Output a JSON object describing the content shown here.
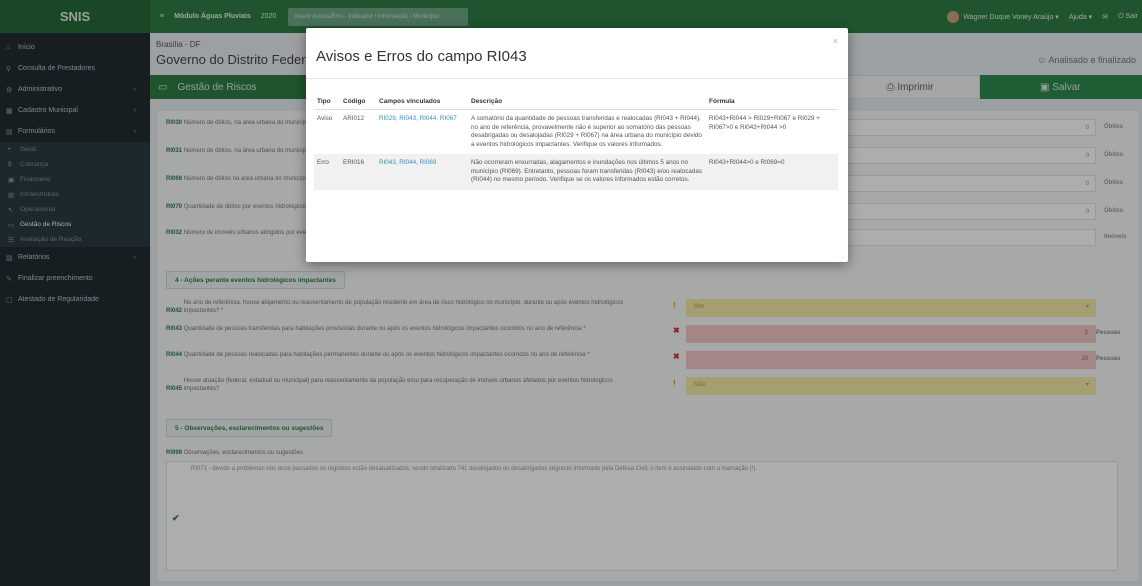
{
  "topbar": {
    "brand": "SNIS",
    "menu_icon": "≡",
    "module": "Módulo Águas Pluviais",
    "year": "2020",
    "search_placeholder": "Inserir Avisos/Erro - Indicador / Informação - Município",
    "user": "Wagner Duque Voney Araújo",
    "help": "Ajuda",
    "exit": "Sair"
  },
  "sidebar": {
    "items": [
      {
        "label": "Início",
        "icon": "home-icon",
        "glyph": "⌂"
      },
      {
        "label": "Consulta de Prestadores",
        "icon": "search-icon",
        "glyph": "⚲"
      },
      {
        "label": "Administrativo",
        "icon": "gear-icon",
        "glyph": "⚙"
      },
      {
        "label": "Cadastro Municipal",
        "icon": "grid-icon",
        "glyph": "▦"
      },
      {
        "label": "Formulários",
        "icon": "forms-icon",
        "glyph": "▤"
      }
    ],
    "subitems": [
      {
        "label": "Geral",
        "glyph": "•"
      },
      {
        "label": "Cobrança",
        "glyph": "$"
      },
      {
        "label": "Financeiro",
        "glyph": "▣"
      },
      {
        "label": "Infraestrutura",
        "glyph": "▥"
      },
      {
        "label": "Operacional",
        "glyph": "↖"
      },
      {
        "label": "Gestão de Riscos",
        "glyph": "▭"
      },
      {
        "label": "Avaliação de Reação",
        "glyph": "☰"
      }
    ],
    "bottom": [
      {
        "label": "Relatórios",
        "glyph": "▨"
      },
      {
        "label": "Finalizar preenchimento",
        "glyph": "✎"
      },
      {
        "label": "Atestado de Regularidade",
        "glyph": "▢"
      }
    ]
  },
  "main": {
    "breadcrumb": "Brasília - DF",
    "org": "Governo do Distrito Federal",
    "status": "Analisado e finalizado",
    "section_title": "Gestão de Riscos",
    "print_label": "Imprimir",
    "save_label": "Salvar",
    "rows": [
      {
        "code": "RI030",
        "text": "Número de óbitos, na área urbana do município, decorrentes de eventos hidrológicos impactantes no ano de referência, registrado no sistema eletrônico da Secretaria",
        "value": "0",
        "unit": "Óbitos"
      },
      {
        "code": "RI031",
        "text": "Número de óbitos, na área urbana do município, decorrentes de eventos hidrológicos impactantes no ano de referência, registrado no sistema eletrônico da Secretaria",
        "value": "0",
        "unit": "Óbitos"
      },
      {
        "code": "RI068",
        "text": "Número de óbitos na área urbana do município decorrentes de eventos hidrológicos impactantes no ano de referência que não foi registrado no sistema eletrônico",
        "value": "0",
        "unit": "Óbitos"
      },
      {
        "code": "RI070",
        "text": "Quantidade de óbitos por eventos hidrológicos impactantes",
        "value": "0",
        "unit": "Óbitos"
      },
      {
        "code": "RI032",
        "text": "Número de imóveis urbanos atingidos por eventos hidrológicos impactantes",
        "value": "",
        "unit": "Imóveis"
      }
    ],
    "section4": "4 - Ações perante eventos hidrológicos impactantes",
    "questions": [
      {
        "code": "RI042",
        "text": "No ano de referência, houve alojamento ou reassentamento de população residente em área de risco hidrológico no município, durante ou após eventos hidrológicos impactantes? *",
        "value": "Sim",
        "kind": "yes",
        "mark": "!",
        "unit": ""
      },
      {
        "code": "RI043",
        "text": "Quantidade de pessoas transferidas para habitações provisórias durante ou após os eventos hidrológicos impactantes ocorridos no ano de referência *",
        "value": "2",
        "kind": "err",
        "mark": "✖",
        "unit": "Pessoas"
      },
      {
        "code": "RI044",
        "text": "Quantidade de pessoas realocadas para habitações permanentes durante ou após os eventos hidrológicos impactantes ocorridos no ano de referência *",
        "value": "10",
        "kind": "err",
        "mark": "✖",
        "unit": "Pessoas"
      },
      {
        "code": "RI045",
        "text": "Houve atuação (federal, estadual ou municipal) para reassentamento da população e/ou para recuperação de imóveis urbanos afetados por eventos hidrológicos impactantes?",
        "value": "Não",
        "kind": "yes",
        "mark": "!",
        "unit": ""
      }
    ],
    "section5": "5 - Observações, esclarecimentos ou sugestões",
    "obs_code": "RI999",
    "obs_label": "Observações, esclarecimentos ou sugestões",
    "obs_text": "RI071 - devido a problemas nos anos passados os registros estão desatualizados, sendo totalizado 741 desalojados ou desabrigados segundo informado pela Defesa Civil; o item é assinalado com a marcação (!)."
  },
  "modal": {
    "title": "Avisos e Erros do campo RI043",
    "close": "×",
    "headers": [
      "Tipo",
      "Código",
      "Campos vinculados",
      "Descrição",
      "Fórmula"
    ],
    "rows": [
      {
        "tipo": "Aviso",
        "codigo": "ARI012",
        "campos": "RI029, RI043, RI044, RI067",
        "descricao": "A somatório da quantidade de pessoas transferidas e realocadas (RI043 + RI044), no ano de referência, provavelmente não é superior ao somatório das pessoas desabrigadas ou desalojadas (RI029 + RI067) na área urbana do município devido a eventos hidrológicos impactantes. Verifique os valores informados.",
        "formula": "RI043+RI044 > RI029+RI067 e RI029 + RI067>0 e RI043+RI044 >0"
      },
      {
        "tipo": "Erro",
        "codigo": "ERI016",
        "campos": "RI043, RI044, RI069",
        "descricao": "Não ocorreram enxurradas, alagamentos e inundações nos últimos 5 anos no município (RI069). Entretanto, pessoas foram transferidas (RI043) e/ou realocadas (RI044) no mesmo período. Verifique se os valores informados estão corretos.",
        "formula": "RI043+RI044>0 e RI069=0"
      }
    ]
  }
}
